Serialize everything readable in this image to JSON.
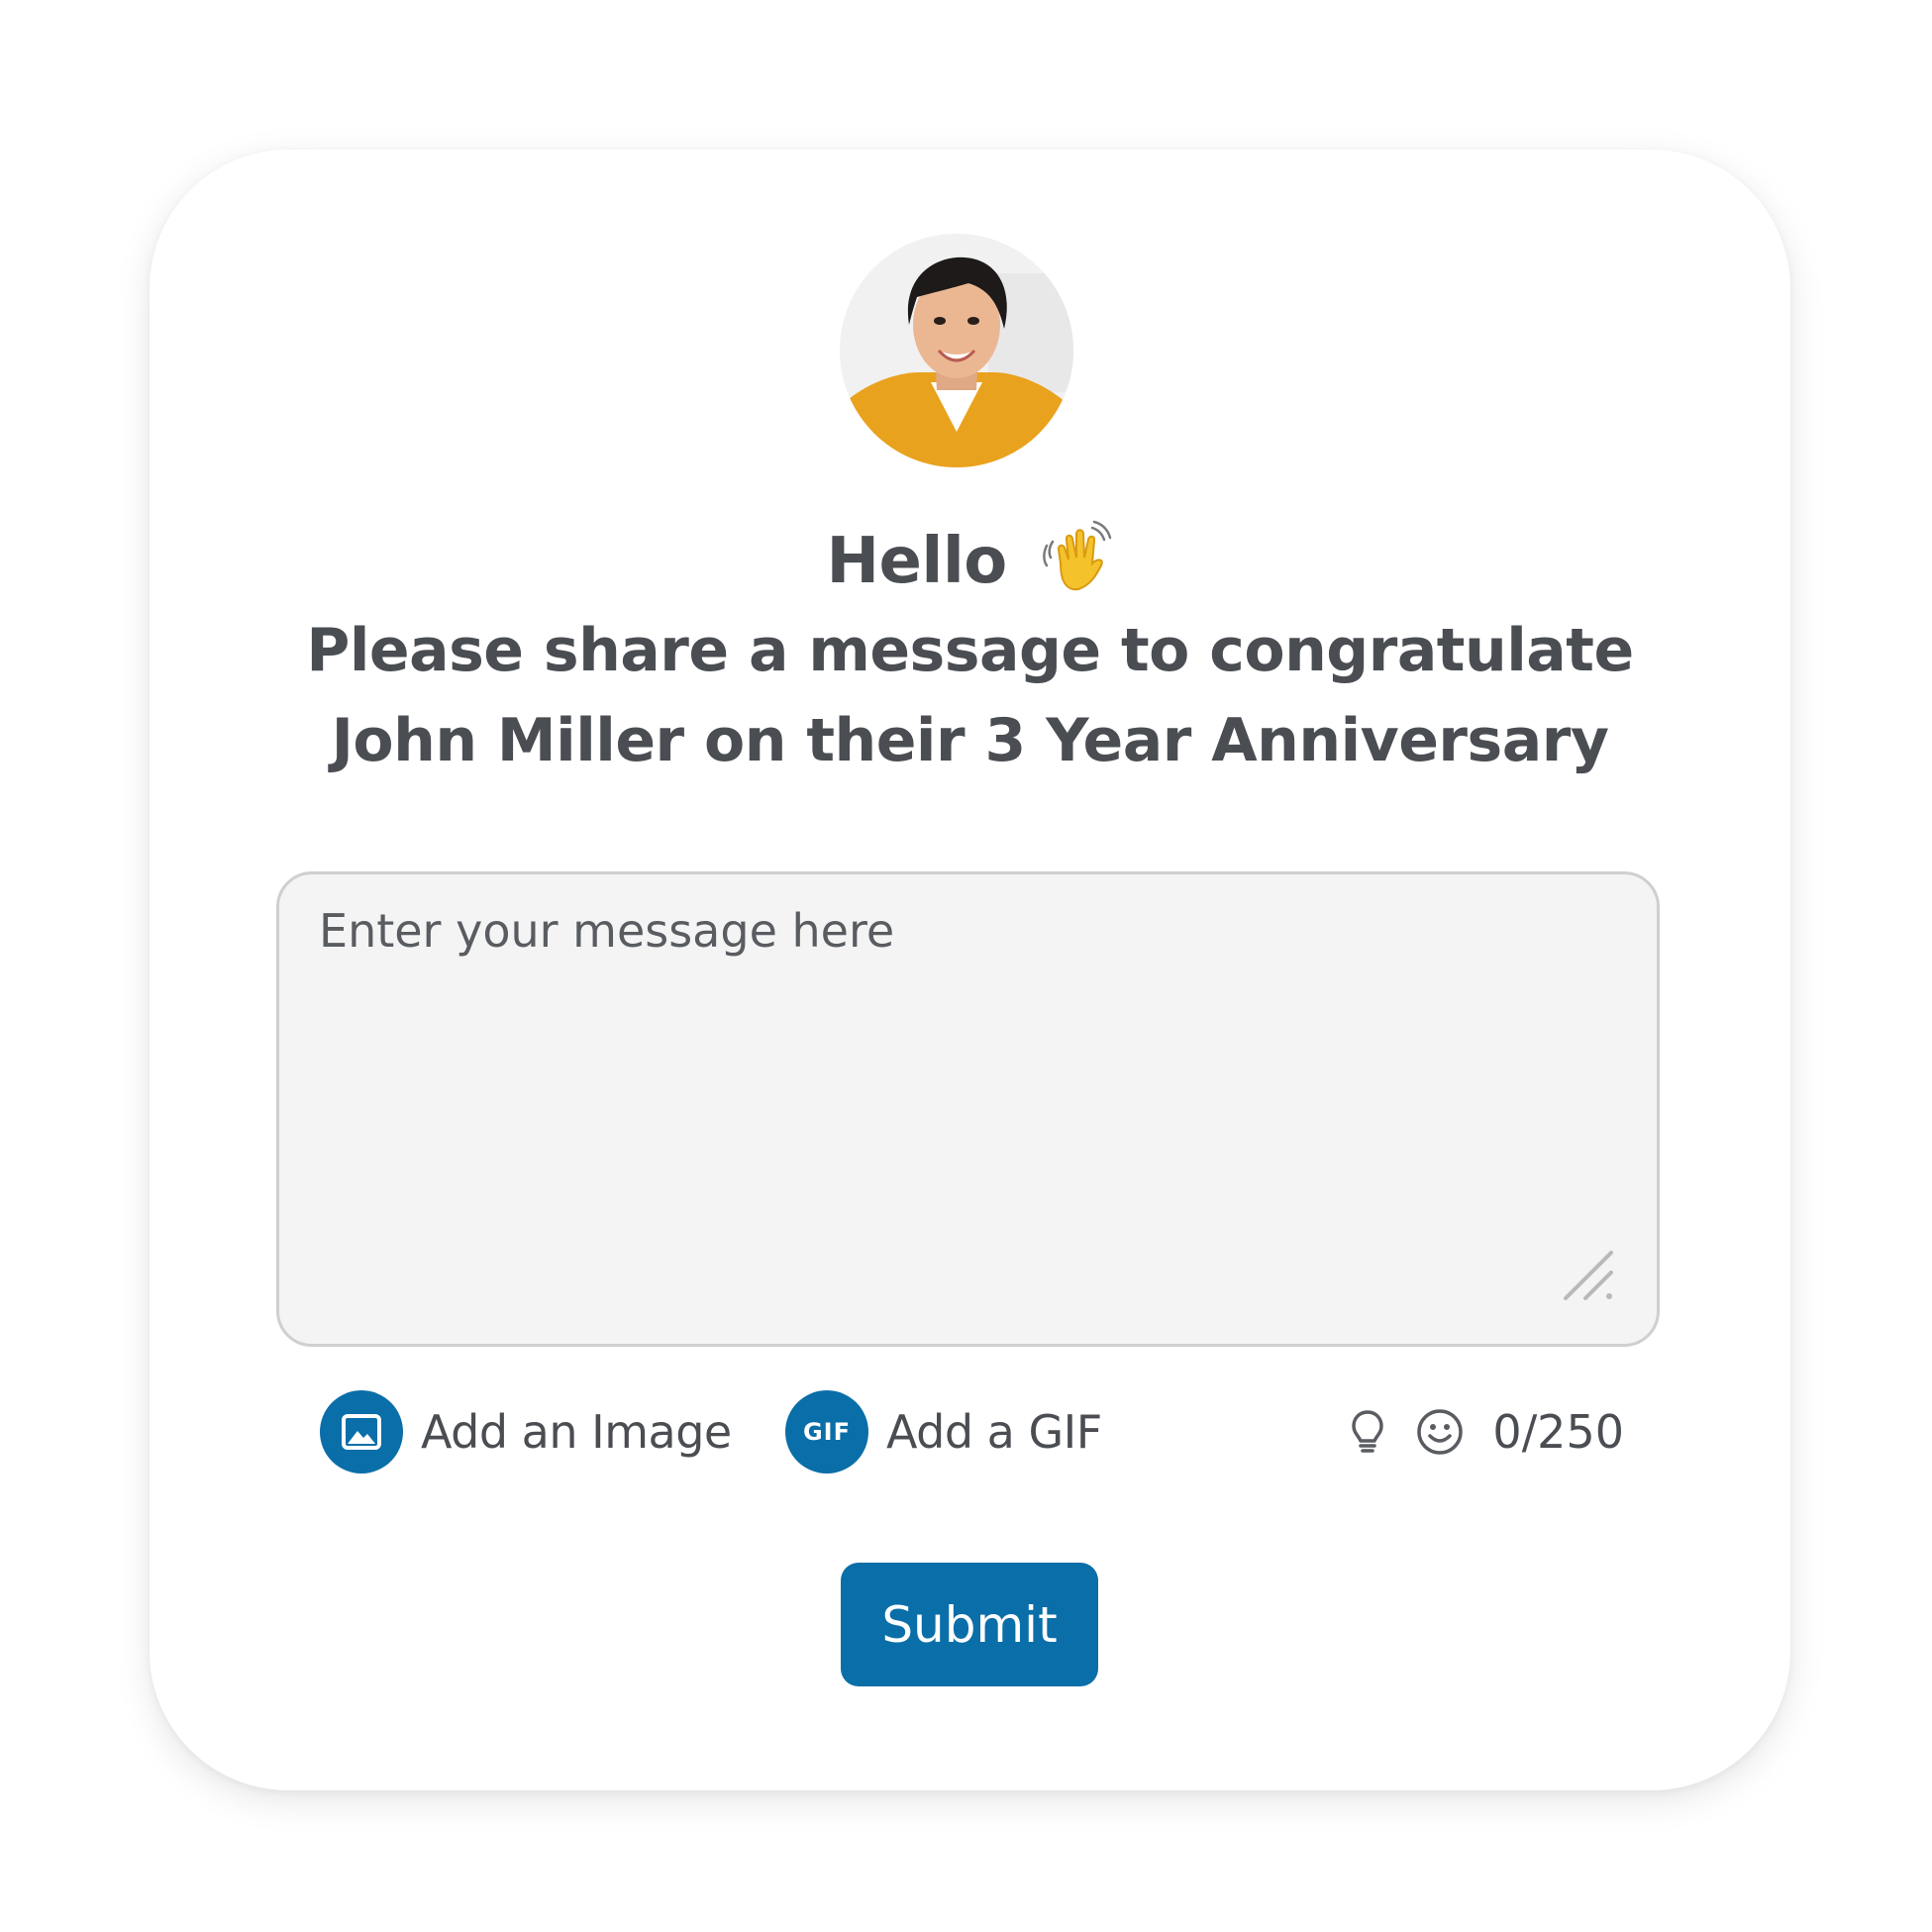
{
  "greeting": {
    "hello": "Hello",
    "wave_icon": "waving-hand-emoji",
    "prompt_line1": "Please share a message to congratulate",
    "prompt_line2": "John Miller on their 3 Year Anniversary"
  },
  "avatar": {
    "alt": "Profile photo"
  },
  "message": {
    "placeholder": "Enter your message here",
    "value": ""
  },
  "toolbar": {
    "add_image_label": "Add an Image",
    "add_image_icon": "image-icon",
    "add_gif_label": "Add a GIF",
    "add_gif_icon_text": "GIF",
    "bulb_icon": "lightbulb-icon",
    "emoji_icon": "smiley-icon",
    "char_count": "0/250"
  },
  "submit": {
    "label": "Submit"
  },
  "colors": {
    "accent": "#0a6ea8",
    "text": "#4a4d52",
    "input_bg": "#f4f4f4",
    "input_border": "#cfcfcf"
  }
}
